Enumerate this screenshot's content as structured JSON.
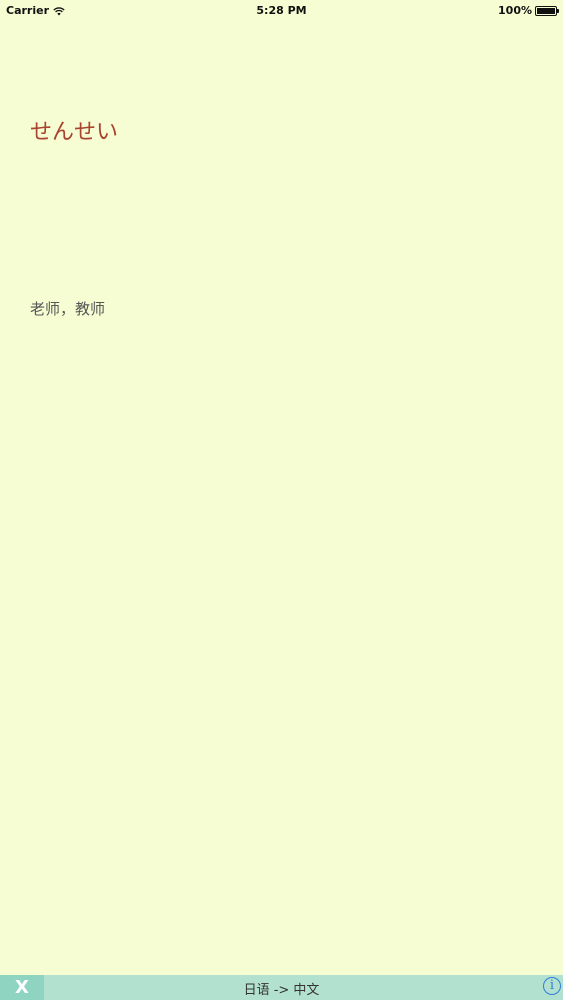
{
  "status_bar": {
    "carrier": "Carrier",
    "wifi_icon": "wifi-icon",
    "time": "5:28 PM",
    "battery": "100%",
    "battery_level": 1.0,
    "battery_icon": "battery-icon"
  },
  "card": {
    "word": "せんせい",
    "meaning": "老师，教师"
  },
  "toolbar": {
    "close_label": "X",
    "close_icon": "close-icon",
    "mode": "日语 -> 中文",
    "info_label": "i",
    "info_icon": "info-icon"
  },
  "colors": {
    "background": "#f6fdd2",
    "word": "#a9432f",
    "meaning": "#555555",
    "toolbar": "#b3e1d0",
    "close_button": "#8fd3c1",
    "info": "#2f7fd8"
  }
}
